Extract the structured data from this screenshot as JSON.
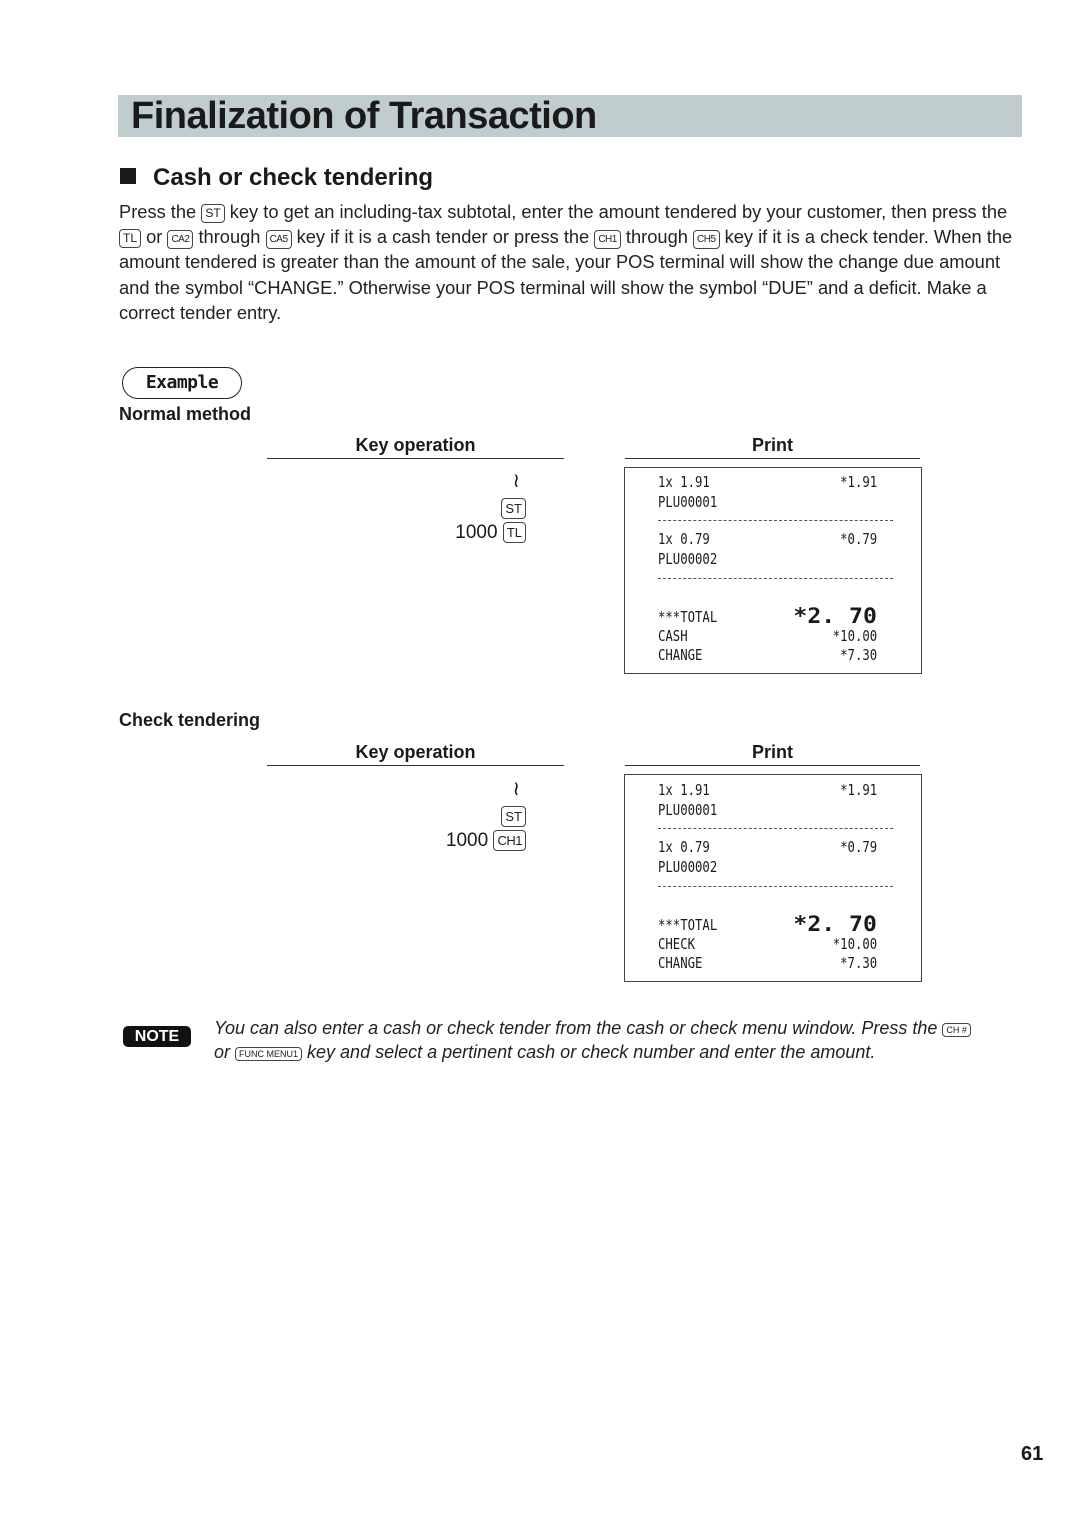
{
  "page": {
    "title": "Finalization of Transaction",
    "section_title": "Cash or check tendering",
    "page_number": "61"
  },
  "intro": {
    "t1": "Press the ",
    "k_st": "ST",
    "t2": " key to get an including-tax subtotal, enter the amount tendered by your customer, then press the ",
    "k_tl": "TL",
    "t3": " or ",
    "k_ca2": "CA2",
    "t4": " through ",
    "k_ca5": "CA5",
    "t5": " key if it is a cash tender or press the ",
    "k_ch1": "CH1",
    "t6": " through ",
    "k_ch5": "CH5",
    "t7": " key if it is a check tender. When the amount tendered is greater than the amount of the sale, your POS terminal will show the change due amount and the symbol “CHANGE.”  Otherwise your POS terminal will show the symbol “DUE” and a deficit.  Make a correct tender entry."
  },
  "example_label": "Example",
  "examples": [
    {
      "heading": "Normal method",
      "key_op_header": "Key operation",
      "print_header": "Print",
      "keys": {
        "tilde": "≀",
        "subtotal_key": "ST",
        "amount": "1000",
        "tender_key": "TL"
      },
      "receipt": {
        "items": [
          {
            "qty_price": "1x 1.91",
            "amount": "*1.91",
            "name": "PLU00001"
          },
          {
            "qty_price": "1x 0.79",
            "amount": "*0.79",
            "name": "PLU00002"
          }
        ],
        "total_label": "***TOTAL",
        "total": "*2. 70",
        "tender_label": "CASH",
        "tender": "*10.00",
        "change_label": "CHANGE",
        "change": "*7.30"
      }
    },
    {
      "heading": "Check tendering",
      "key_op_header": "Key operation",
      "print_header": "Print",
      "keys": {
        "tilde": "≀",
        "subtotal_key": "ST",
        "amount": "1000",
        "tender_key": "CH1"
      },
      "receipt": {
        "items": [
          {
            "qty_price": "1x 1.91",
            "amount": "*1.91",
            "name": "PLU00001"
          },
          {
            "qty_price": "1x 0.79",
            "amount": "*0.79",
            "name": "PLU00002"
          }
        ],
        "total_label": "***TOTAL",
        "total": "*2. 70",
        "tender_label": "CHECK",
        "tender": "*10.00",
        "change_label": "CHANGE",
        "change": "*7.30"
      }
    }
  ],
  "note": {
    "badge": "NOTE",
    "t1": "You can also enter a cash or check tender from the cash or check menu window. Press the ",
    "k_ch": "CH #",
    "t2": " or ",
    "k_func": "FUNC MENU1",
    "t3": " key and select a pertinent cash or check number and enter the amount."
  }
}
